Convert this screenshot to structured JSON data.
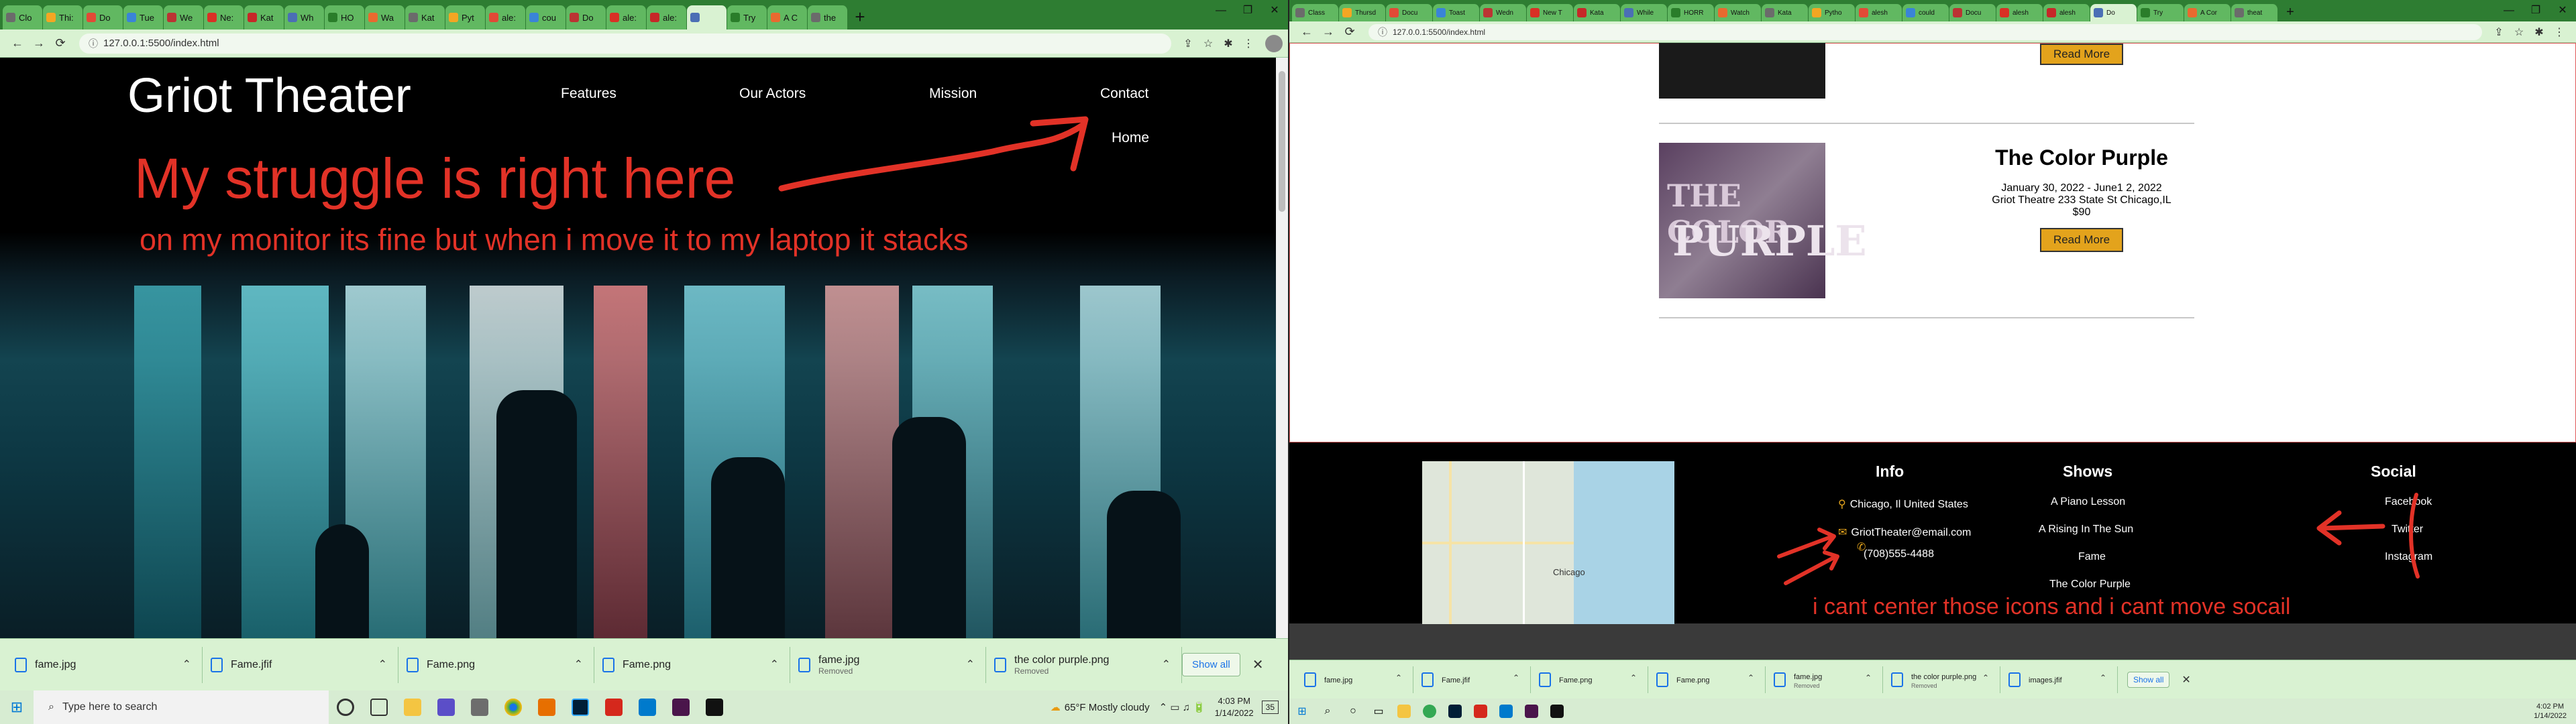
{
  "left": {
    "tabs": [
      "Clo",
      "Thi:",
      "Do",
      "Tue",
      "We",
      "Ne:",
      "Kat",
      "Wh",
      "HO",
      "Wa",
      "Kat",
      "Pyt",
      "ale:",
      "cou",
      "Do",
      "ale:",
      "ale:",
      "",
      "Try",
      "A C",
      "the"
    ],
    "url": "127.0.0.1:5500/index.html",
    "page": {
      "logo": "Griot Theater",
      "nav": [
        "Features",
        "Our Actors",
        "Mission",
        "Contact",
        "Home"
      ]
    },
    "annotations": {
      "struggle": "My struggle is right here",
      "stack": "on my monitor its fine but when i move it to my laptop it stacks"
    },
    "downloads": [
      {
        "name": "fame.jpg",
        "sub": ""
      },
      {
        "name": "Fame.jfif",
        "sub": ""
      },
      {
        "name": "Fame.png",
        "sub": ""
      },
      {
        "name": "Fame.png",
        "sub": ""
      },
      {
        "name": "fame.jpg",
        "sub": "Removed"
      },
      {
        "name": "the color purple.png",
        "sub": "Removed"
      }
    ],
    "show_all": "Show all",
    "taskbar": {
      "search": "Type here to search",
      "weather": "65°F  Mostly cloudy",
      "time": "4:03 PM",
      "date": "1/14/2022",
      "badge": "35"
    }
  },
  "right": {
    "tabs": [
      "Class",
      "Thursd",
      "Docu",
      "Toast",
      "Wedn",
      "New T",
      "Kata",
      "While",
      "HORR",
      "Watch",
      "Kata",
      "Pytho",
      "alesh",
      "could",
      "Docu",
      "alesh",
      "alesh",
      "Do",
      "Try",
      "A Cor",
      "theat"
    ],
    "url": "127.0.0.1:5500/index.html",
    "page": {
      "read_more": "Read More",
      "movie": {
        "title": "The Color Purple",
        "dates": "January 30, 2022 - June1 2, 2022",
        "venue": "Griot Theatre 233 State St Chicago,IL",
        "price": "$90",
        "poster_line1": "THE COLOR",
        "poster_line2": "PURPLE"
      },
      "footer": {
        "info_title": "Info",
        "info_items": [
          "Chicago, Il United States",
          "GriotTheater@email.com",
          "(708)555-4488"
        ],
        "shows_title": "Shows",
        "shows": [
          "A Piano Lesson",
          "A Rising In The Sun",
          "Fame",
          "The Color Purple"
        ],
        "social_title": "Social",
        "social": [
          "Facebook",
          "Twitter",
          "Instagram"
        ],
        "map_label": "Chicago"
      }
    },
    "annotation": "i cant center those icons and i cant move socail",
    "downloads": [
      "fame.jpg",
      "Fame.jfif",
      "Fame.png",
      "Fame.png",
      "fame.jpg",
      "the color purple.png",
      "images.jfif"
    ],
    "downloads_sub": [
      "",
      "",
      "",
      "",
      "Removed",
      "Removed",
      ""
    ],
    "show_all": "Show all",
    "taskbar": {
      "time": "4:02 PM",
      "date": "1/14/2022"
    }
  },
  "colors": {
    "annotation": "#e23227",
    "read_more": "#e3a31c",
    "tab_active": "#d9f2d2",
    "tabbar": "#2e7d32"
  }
}
